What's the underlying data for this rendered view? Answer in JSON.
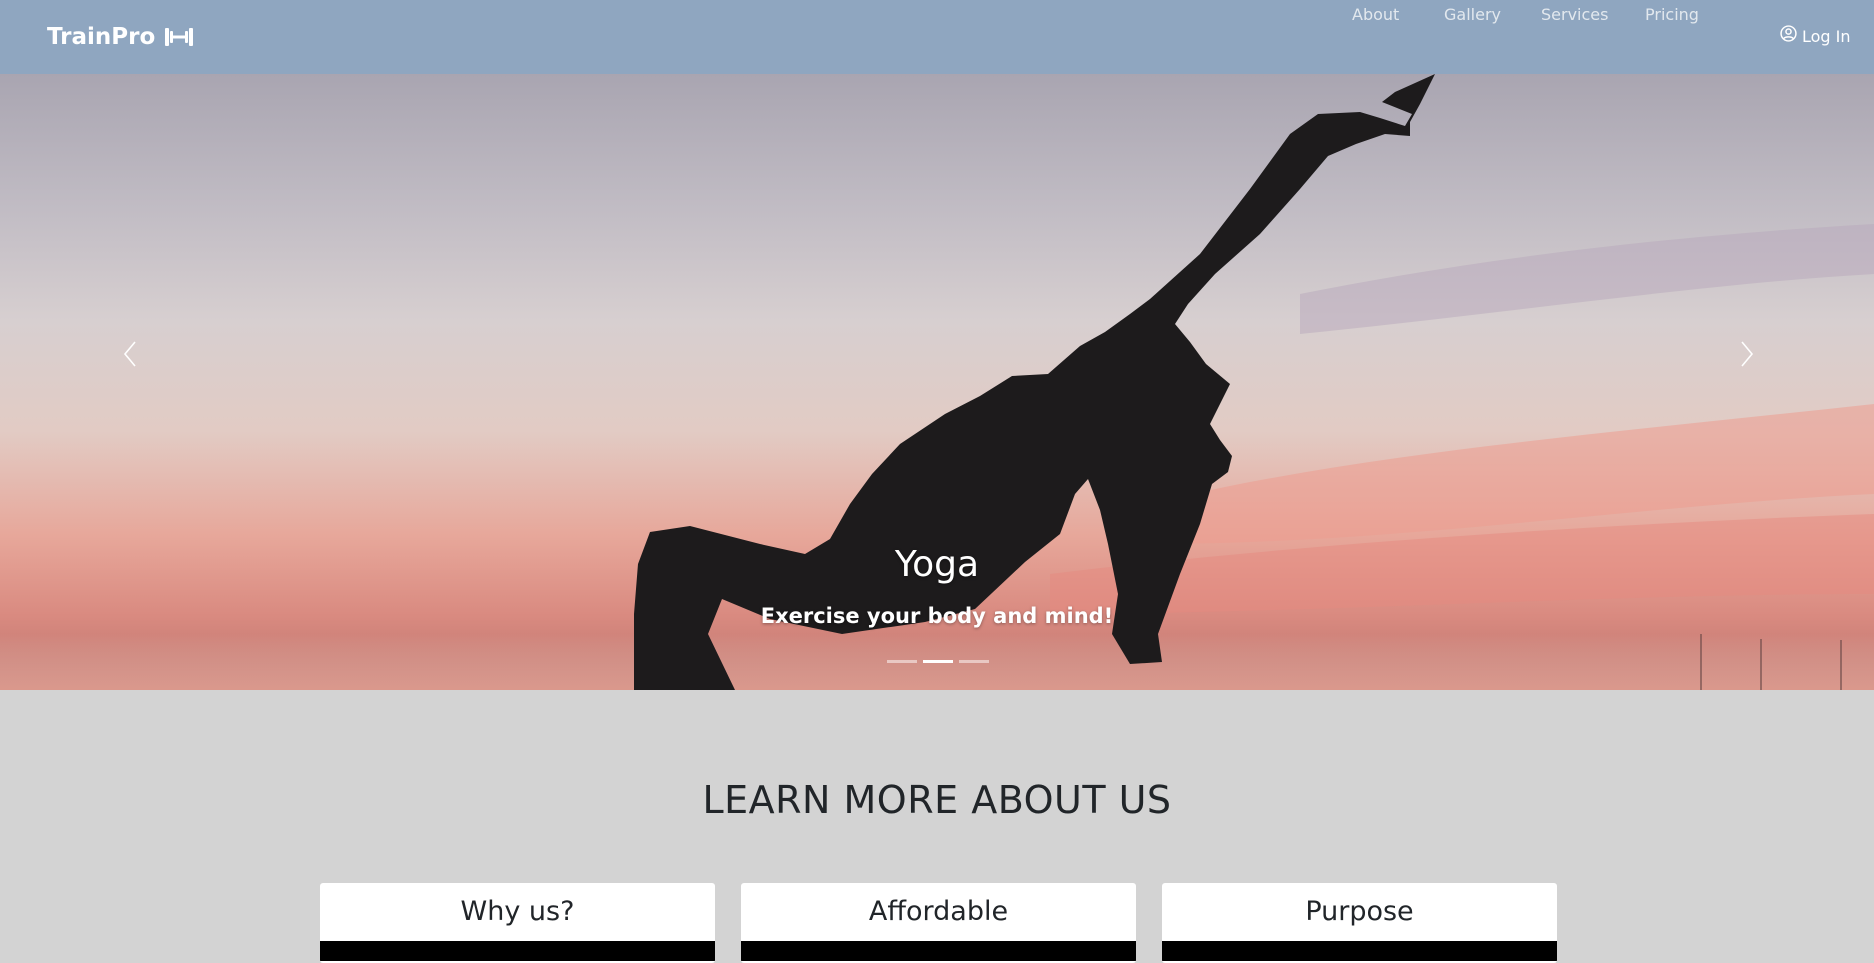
{
  "navbar": {
    "brand": "TrainPro",
    "brand_icon": "dumbbell-icon",
    "links": [
      "About",
      "Gallery",
      "Services",
      "Pricing"
    ],
    "login_label": "Log In",
    "login_icon": "user-circle-icon",
    "background": "#8fa6c0"
  },
  "carousel": {
    "slide_title": "Yoga",
    "slide_subtitle": "Exercise your body and mind!",
    "indicator_count": 3,
    "active_index": 1,
    "prev_icon": "chevron-left-icon",
    "next_icon": "chevron-right-icon"
  },
  "about": {
    "heading": "LEARN MORE ABOUT US",
    "cards": [
      {
        "title": "Why us?"
      },
      {
        "title": "Affordable"
      },
      {
        "title": "Purpose"
      }
    ]
  }
}
